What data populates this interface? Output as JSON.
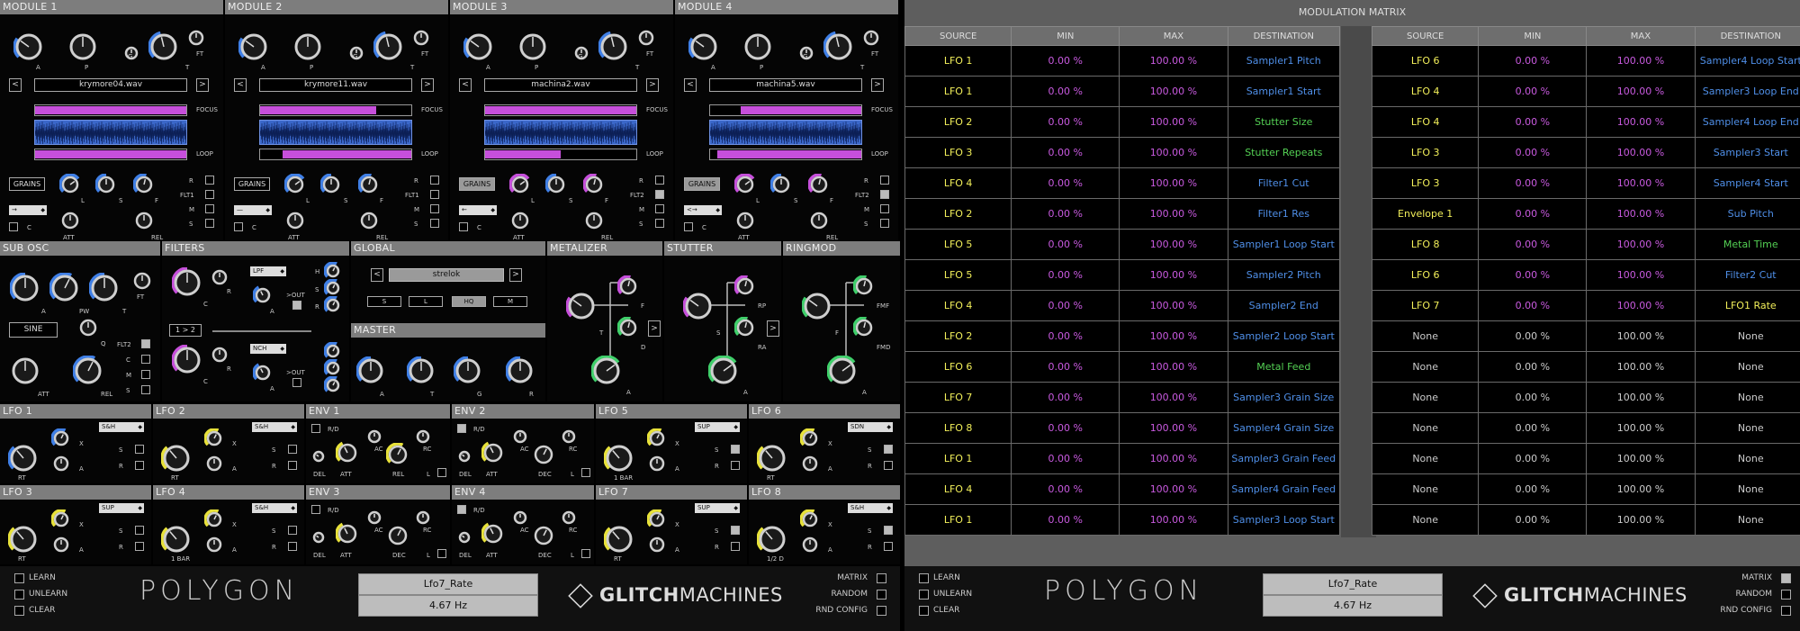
{
  "modules": [
    {
      "title": "MODULE 1",
      "file": "krymore04.wav",
      "filter": "FLT1",
      "sel": "→"
    },
    {
      "title": "MODULE 2",
      "file": "krymore11.wav",
      "filter": "FLT1",
      "sel": "—"
    },
    {
      "title": "MODULE 3",
      "file": "machina2.wav",
      "filter": "FLT2",
      "sel": "←"
    },
    {
      "title": "MODULE 4",
      "file": "machina5.wav",
      "filter": "FLT2",
      "sel": "<→"
    }
  ],
  "module_labels": {
    "a": "A",
    "p": "P",
    "g": "G",
    "t": "T",
    "ft": "FT",
    "focus": "FOCUS",
    "loop": "LOOP",
    "grains": "GRAINS",
    "l": "L",
    "s": "S",
    "f": "F",
    "r": "R",
    "m": "M",
    "c": "C",
    "att": "ATT",
    "rel": "REL",
    "prev": "<",
    "next": ">"
  },
  "sections": {
    "sub_osc": "SUB OSC",
    "filters": "FILTERS",
    "global": "GLOBAL",
    "master": "MASTER",
    "metalizer": "METALIZER",
    "stutter": "STUTTER",
    "ringmod": "RINGMOD"
  },
  "sub_osc": {
    "wave": "SINE",
    "labels": {
      "a": "A",
      "pw": "PW",
      "t": "T",
      "ft": "FT",
      "q": "Q",
      "flt2": "FLT2",
      "c": "C",
      "m": "M",
      "s": "S",
      "att": "ATT",
      "rel": "REL"
    }
  },
  "filters": {
    "type1": "LPF",
    "type2": "NCH",
    "routing": "1 > 2",
    "labels": {
      "c": "C",
      "r": "R",
      "a": "A",
      "out": ">OUT",
      "h": "H",
      "s": "S"
    }
  },
  "global": {
    "preset": "strelok",
    "buttons": [
      "S",
      "L",
      "HQ",
      "M"
    ],
    "prev": "<",
    "next": ">"
  },
  "master": {
    "labels": [
      "A",
      "T",
      "G",
      "R"
    ]
  },
  "fx": {
    "metal": [
      "F",
      "T",
      "D"
    ],
    "stutter": [
      "RP",
      "S",
      "RA"
    ],
    "ring": [
      "FMF",
      "F",
      "FMD"
    ],
    "arrow": ">"
  },
  "lfos": [
    {
      "title": "LFO 1",
      "mode": "S&H",
      "rate": "RT"
    },
    {
      "title": "LFO 2",
      "mode": "S&H",
      "rate": "RT"
    },
    {
      "title": "LFO 5",
      "mode": "SUP",
      "rate": "1 BAR"
    },
    {
      "title": "LFO 6",
      "mode": "SDN",
      "rate": "RT"
    },
    {
      "title": "LFO 3",
      "mode": "SUP",
      "rate": "RT"
    },
    {
      "title": "LFO 4",
      "mode": "S&H",
      "rate": "1 BAR"
    },
    {
      "title": "LFO 7",
      "mode": "SUP",
      "rate": "RT"
    },
    {
      "title": "LFO 8",
      "mode": "S&H",
      "rate": "1/2 D"
    }
  ],
  "lfo_labels": {
    "x": "X",
    "a": "A",
    "s": "S",
    "r": "R"
  },
  "envs": [
    {
      "title": "ENV 1",
      "last": "REL"
    },
    {
      "title": "ENV 2",
      "last": "DEC"
    },
    {
      "title": "ENV 3",
      "last": "DEC"
    },
    {
      "title": "ENV 4",
      "last": "DEC"
    }
  ],
  "env_labels": {
    "rd": "R/D",
    "del": "DEL",
    "att": "ATT",
    "ac": "AC",
    "rc": "RC",
    "l": "L"
  },
  "bottom": {
    "checks": [
      "LEARN",
      "UNLEARN",
      "CLEAR"
    ],
    "param_name": "Lfo7_Rate",
    "param_value": "4.67 Hz",
    "right_checks": [
      "MATRIX",
      "RANDOM",
      "RND CONFIG"
    ],
    "logo": "POLYGON",
    "brand_a": "GLITCH",
    "brand_b": "MACHINES"
  },
  "matrix": {
    "title": "MODULATION MATRIX",
    "headers": [
      "SOURCE",
      "MIN",
      "MAX",
      "DESTINATION"
    ],
    "left": [
      [
        "LFO 1",
        "0.00 %",
        "100.00 %",
        "Sampler1 Pitch",
        "blue"
      ],
      [
        "LFO 1",
        "0.00 %",
        "100.00 %",
        "Sampler1 Start",
        "blue"
      ],
      [
        "LFO 2",
        "0.00 %",
        "100.00 %",
        "Stutter Size",
        "green"
      ],
      [
        "LFO 3",
        "0.00 %",
        "100.00 %",
        "Stutter Repeats",
        "green"
      ],
      [
        "LFO 4",
        "0.00 %",
        "100.00 %",
        "Filter1 Cut",
        "blue"
      ],
      [
        "LFO 2",
        "0.00 %",
        "100.00 %",
        "Filter1 Res",
        "blue"
      ],
      [
        "LFO 5",
        "0.00 %",
        "100.00 %",
        "Sampler1 Loop Start",
        "blue"
      ],
      [
        "LFO 5",
        "0.00 %",
        "100.00 %",
        "Sampler2 Pitch",
        "blue"
      ],
      [
        "LFO 4",
        "0.00 %",
        "100.00 %",
        "Sampler2 End",
        "blue"
      ],
      [
        "LFO 2",
        "0.00 %",
        "100.00 %",
        "Sampler2 Loop Start",
        "blue"
      ],
      [
        "LFO 6",
        "0.00 %",
        "100.00 %",
        "Metal Feed",
        "green"
      ],
      [
        "LFO 7",
        "0.00 %",
        "100.00 %",
        "Sampler3 Grain Size",
        "blue"
      ],
      [
        "LFO 8",
        "0.00 %",
        "100.00 %",
        "Sampler4 Grain Size",
        "blue"
      ],
      [
        "LFO 1",
        "0.00 %",
        "100.00 %",
        "Sampler3 Grain Feed",
        "blue"
      ],
      [
        "LFO 4",
        "0.00 %",
        "100.00 %",
        "Sampler4 Grain Feed",
        "blue"
      ],
      [
        "LFO 1",
        "0.00 %",
        "100.00 %",
        "Sampler3 Loop Start",
        "blue"
      ]
    ],
    "right": [
      [
        "LFO 6",
        "0.00 %",
        "100.00 %",
        "Sampler4 Loop Start",
        "blue"
      ],
      [
        "LFO 4",
        "0.00 %",
        "100.00 %",
        "Sampler3 Loop End",
        "blue"
      ],
      [
        "LFO 4",
        "0.00 %",
        "100.00 %",
        "Sampler4 Loop End",
        "blue"
      ],
      [
        "LFO 3",
        "0.00 %",
        "100.00 %",
        "Sampler3 Start",
        "blue"
      ],
      [
        "LFO 3",
        "0.00 %",
        "100.00 %",
        "Sampler4 Start",
        "blue"
      ],
      [
        "Envelope 1",
        "0.00 %",
        "100.00 %",
        "Sub Pitch",
        "blue"
      ],
      [
        "LFO 8",
        "0.00 %",
        "100.00 %",
        "Metal Time",
        "green"
      ],
      [
        "LFO 6",
        "0.00 %",
        "100.00 %",
        "Filter2 Cut",
        "blue"
      ],
      [
        "LFO 7",
        "0.00 %",
        "100.00 %",
        "LFO1 Rate",
        "yellow"
      ],
      [
        "None",
        "0.00 %",
        "100.00 %",
        "None",
        "none"
      ],
      [
        "None",
        "0.00 %",
        "100.00 %",
        "None",
        "none"
      ],
      [
        "None",
        "0.00 %",
        "100.00 %",
        "None",
        "none"
      ],
      [
        "None",
        "0.00 %",
        "100.00 %",
        "None",
        "none"
      ],
      [
        "None",
        "0.00 %",
        "100.00 %",
        "None",
        "none"
      ],
      [
        "None",
        "0.00 %",
        "100.00 %",
        "None",
        "none"
      ],
      [
        "None",
        "0.00 %",
        "100.00 %",
        "None",
        "none"
      ]
    ],
    "bottom": {
      "checks": [
        "LEARN",
        "UNLEARN",
        "CLEAR"
      ],
      "param_name": "Lfo7_Rate",
      "param_value": "4.67 Hz",
      "right_checks": [
        "MATRIX",
        "RANDOM",
        "RND CONFIG"
      ]
    }
  },
  "colors": {
    "blue": "#3f7fe6",
    "purple": "#c64fdb",
    "green": "#3fcf6a",
    "yellow": "#e8e23a",
    "knob": "#d0d0d0",
    "hdr": "#7d7d7d"
  }
}
